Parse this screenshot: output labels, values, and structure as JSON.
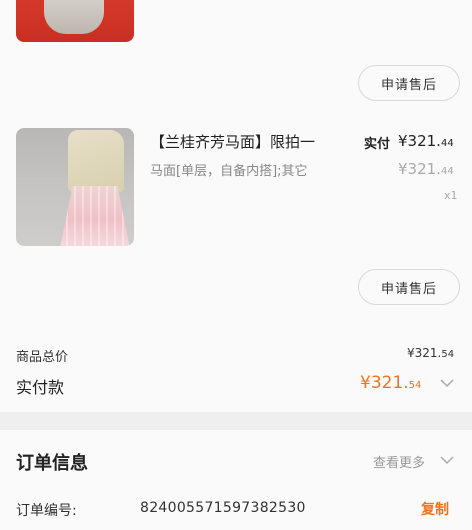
{
  "product_top": {
    "after_sale_label": "申请售后"
  },
  "product_main": {
    "title": "【兰桂齐芳马面】限拍一",
    "spec": "马面[单层，自备内搭];其它",
    "paid_label": "实付",
    "paid_price_main": "¥321.",
    "paid_price_cents": "44",
    "original_price_main": "¥321.",
    "original_price_cents": "44",
    "quantity": "x1",
    "after_sale_label": "申请售后"
  },
  "summary": {
    "total_label": "商品总价",
    "total_main": "¥321.",
    "total_cents": "54",
    "paid_label": "实付款",
    "paid_main": "¥321.",
    "paid_cents": "54"
  },
  "order_info": {
    "title": "订单信息",
    "more_label": "查看更多",
    "order_no_label": "订单编号:",
    "order_no": "824005571597382530",
    "copy_label": "复制"
  },
  "colors": {
    "accent": "#f2731f",
    "muted": "#999999"
  }
}
